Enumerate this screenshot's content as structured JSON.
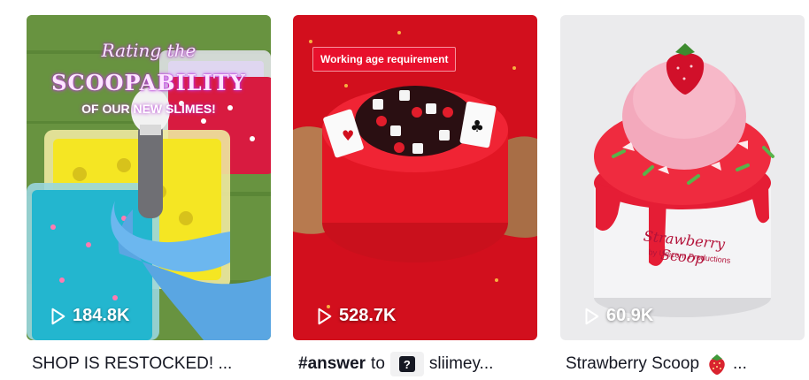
{
  "videos": [
    {
      "views": "184.8K",
      "caption": "SHOP IS RESTOCKED! ...",
      "overlay": {
        "line1": "Rating the",
        "line2": "SCOOPABILITY",
        "line3": "OF OUR NEW SLIMES!"
      }
    },
    {
      "views": "528.7K",
      "badge": "Working age requirement",
      "caption": {
        "tag": "#answer",
        "word": "to",
        "account": "sliimey..."
      }
    },
    {
      "views": "60.9K",
      "caption": {
        "text": "Strawberry Scoop",
        "ellipsis": "..."
      },
      "jar_label": {
        "title": "Strawberry Scoop",
        "subtitle": "by Unicorn Productions"
      }
    }
  ],
  "icons": {
    "play": "play-icon",
    "question": "question-icon",
    "strawberry": "strawberry-emoji"
  }
}
